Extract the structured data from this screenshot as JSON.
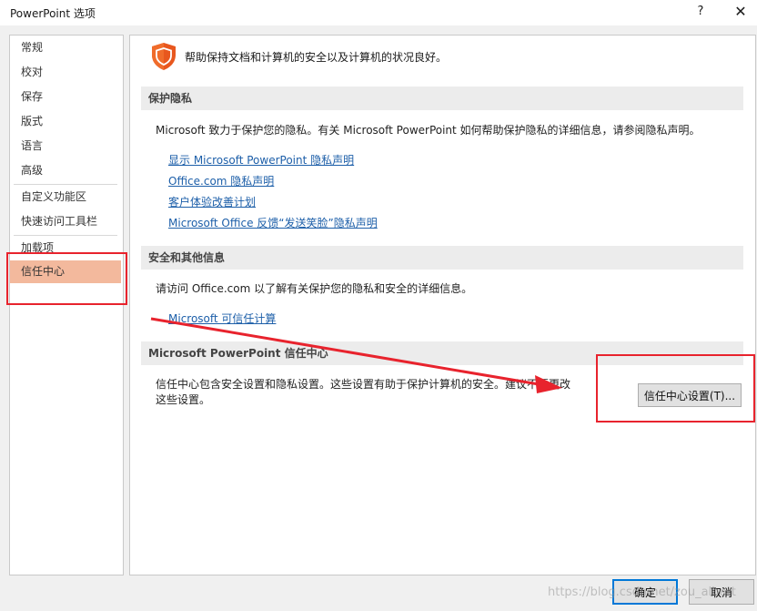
{
  "window": {
    "title": "PowerPoint 选项",
    "help": "?",
    "close": "✕"
  },
  "sidebar": {
    "items": [
      {
        "label": "常规"
      },
      {
        "label": "校对"
      },
      {
        "label": "保存"
      },
      {
        "label": "版式"
      },
      {
        "label": "语言"
      },
      {
        "label": "高级"
      },
      {
        "label": "自定义功能区"
      },
      {
        "label": "快速访问工具栏"
      },
      {
        "label": "加载项"
      },
      {
        "label": "信任中心"
      }
    ],
    "selected": "信任中心"
  },
  "main": {
    "intro": "帮助保持文档和计算机的安全以及计算机的状况良好。",
    "privacy": {
      "header": "保护隐私",
      "text": "Microsoft 致力于保护您的隐私。有关 Microsoft PowerPoint 如何帮助保护隐私的详细信息，请参阅隐私声明。",
      "links": [
        "显示 Microsoft PowerPoint 隐私声明",
        "Office.com 隐私声明",
        "客户体验改善计划",
        "Microsoft Office 反馈“发送笑脸”隐私声明"
      ]
    },
    "security": {
      "header": "安全和其他信息",
      "text": "请访问 Office.com 以了解有关保护您的隐私和安全的详细信息。",
      "link": "Microsoft 可信任计算"
    },
    "trust_center": {
      "header": "Microsoft PowerPoint 信任中心",
      "text_line1": "信任中心包含安全设置和隐私设置。这些设置有助于保护计算机的安全。建议不要更改",
      "text_line2": "这些设置。",
      "button": "信任中心设置(T)..."
    }
  },
  "footer": {
    "ok": "确定",
    "cancel": "取消"
  },
  "watermark": "https://blog.csdn.net/zou_albert",
  "colors": {
    "accent_selected": "#f3b99d",
    "link": "#1d5fa9",
    "annotation": "#e8232d",
    "shield": "#e8571e"
  },
  "icons": {
    "shield": "shield-icon",
    "help": "help-icon",
    "close": "close-icon"
  }
}
